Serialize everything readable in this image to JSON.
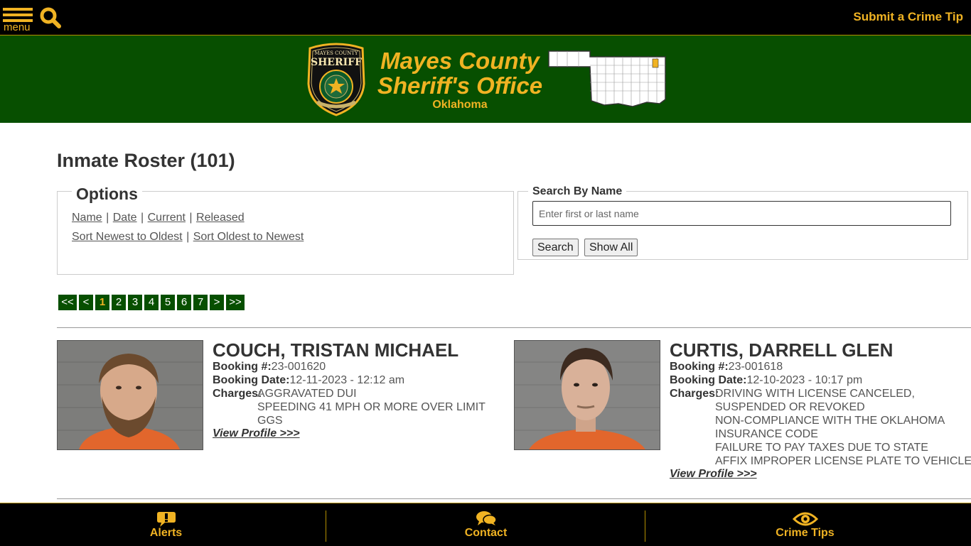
{
  "topbar": {
    "menu_label": "menu",
    "search_icon": "search-icon",
    "crime_tip_link": "Submit a Crime Tip"
  },
  "header": {
    "badge_top": "MAYES COUNTY",
    "badge_main": "SHERIFF",
    "title_line1": "Mayes County",
    "title_line2": "Sheriff's Office",
    "state": "Oklahoma"
  },
  "page": {
    "title": "Inmate Roster (101)"
  },
  "options": {
    "legend": "Options",
    "filters": [
      "Name",
      "Date",
      "Current",
      "Released"
    ],
    "sorts": [
      "Sort Newest to Oldest",
      "Sort Oldest to Newest"
    ],
    "separator": "|"
  },
  "search": {
    "legend": "Search By Name",
    "placeholder": "Enter first or last name",
    "value": "",
    "search_button": "Search",
    "show_all_button": "Show All"
  },
  "pagination": {
    "first": "<<",
    "prev": "<",
    "pages": [
      "1",
      "2",
      "3",
      "4",
      "5",
      "6",
      "7"
    ],
    "current": "1",
    "next": ">",
    "last": ">>"
  },
  "inmates": [
    {
      "name": "COUCH, TRISTAN MICHAEL",
      "booking_label": "Booking #:",
      "booking_number": "23-001620",
      "date_label": "Booking Date:",
      "booking_date": "12-11-2023 - 12:12 am",
      "charges_label": "Charges:",
      "charges": [
        "AGGRAVATED DUI",
        "SPEEDING 41 MPH OR MORE OVER LIMIT",
        "GGS"
      ],
      "view_link": "View Profile >>>"
    },
    {
      "name": "CURTIS, DARRELL GLEN",
      "booking_label": "Booking #:",
      "booking_number": "23-001618",
      "date_label": "Booking Date:",
      "booking_date": "12-10-2023 - 10:17 pm",
      "charges_label": "Charges:",
      "charges": [
        "DRIVING WITH LICENSE CANCELED,",
        "SUSPENDED OR REVOKED",
        "NON-COMPLIANCE WITH THE OKLAHOMA",
        "INSURANCE CODE",
        "FAILURE TO PAY TAXES DUE TO STATE",
        "AFFIX IMPROPER LICENSE PLATE TO VEHICLE"
      ],
      "view_link": "View Profile >>>"
    }
  ],
  "footer": {
    "items": [
      {
        "label": "Alerts",
        "icon": "alert-bubble-icon"
      },
      {
        "label": "Contact",
        "icon": "chat-bubbles-icon"
      },
      {
        "label": "Crime Tips",
        "icon": "eye-icon"
      }
    ]
  },
  "colors": {
    "brand_green": "#074f00",
    "brand_gold": "#f0b323",
    "topbar_black": "#000000"
  }
}
